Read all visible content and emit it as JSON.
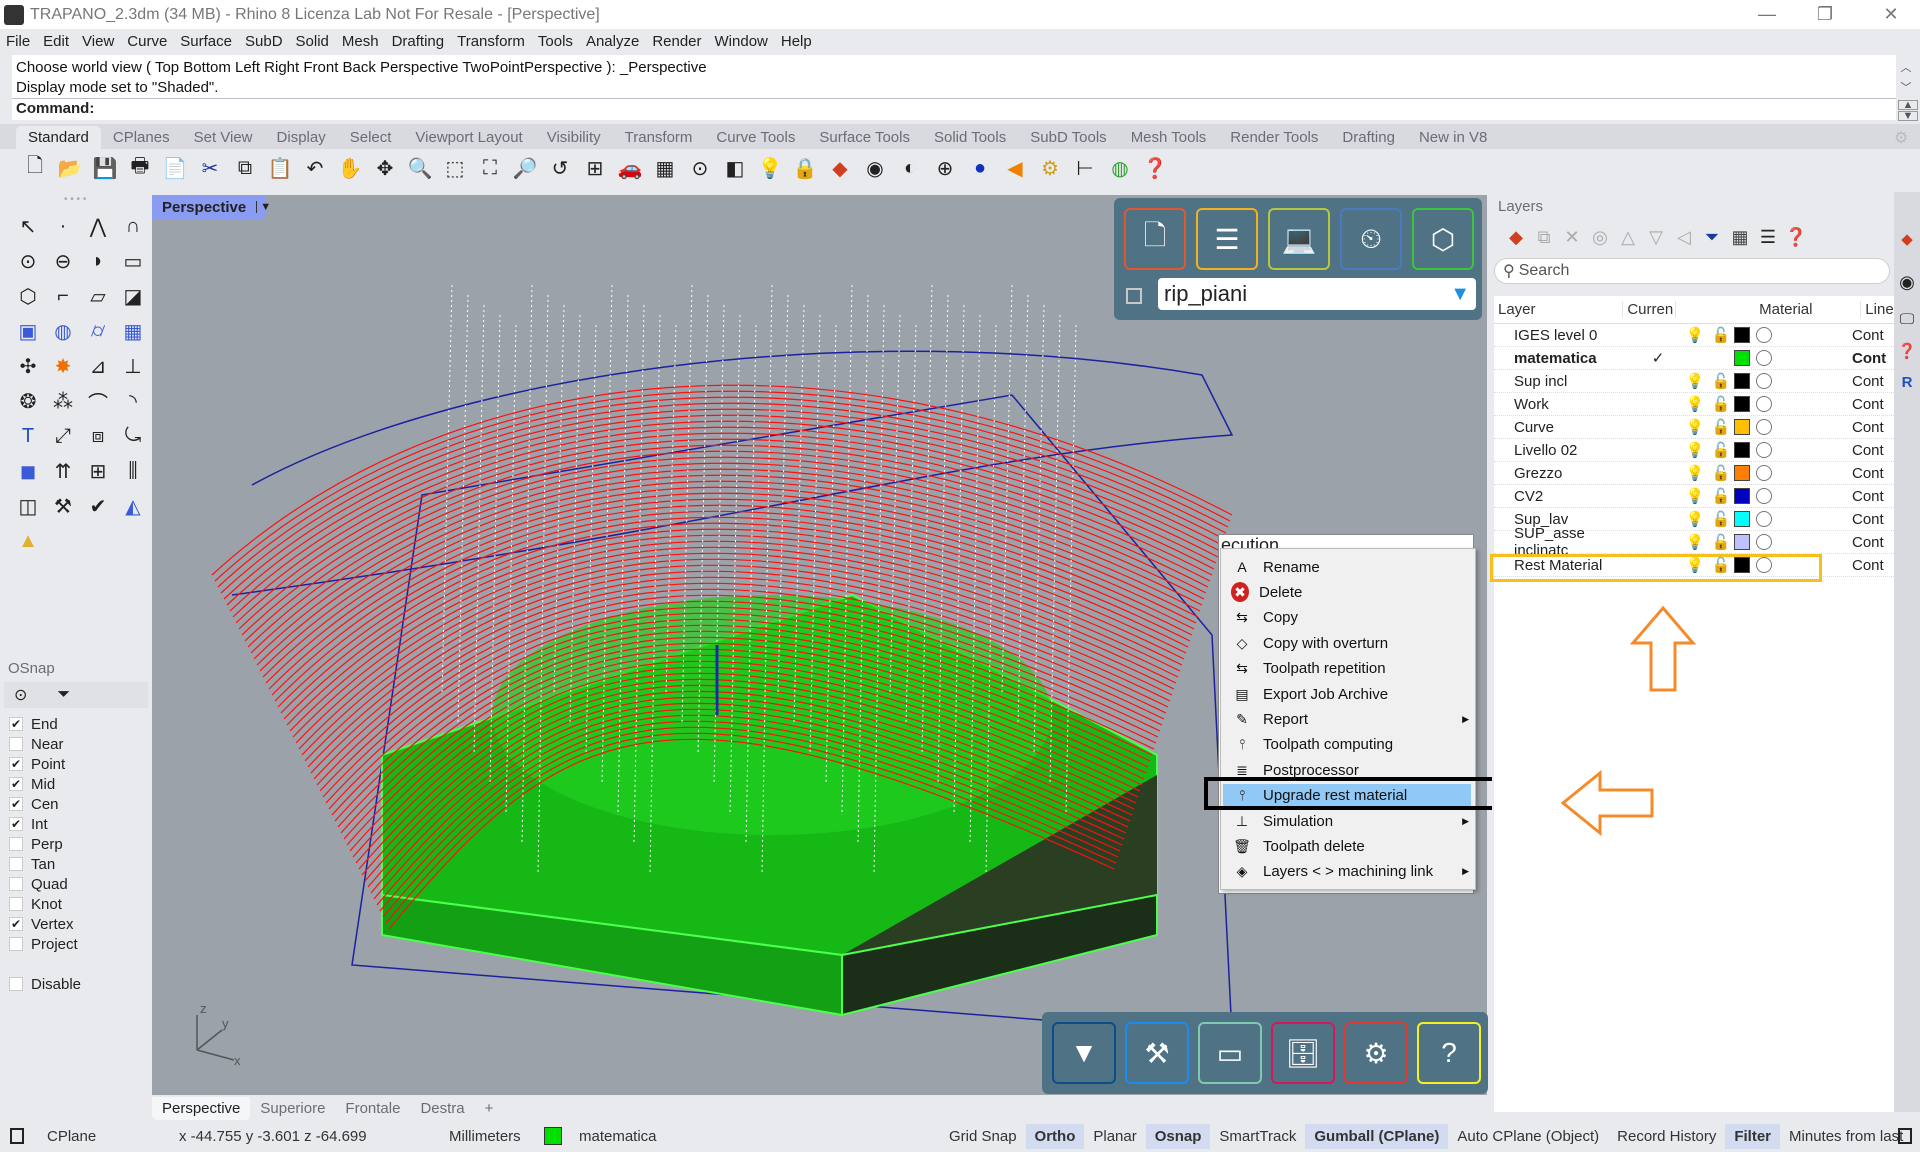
{
  "window": {
    "title": "TRAPANO_2.3dm (34 MB) - Rhino 8 Licenza Lab Not For Resale - [Perspective]",
    "minimize": "—",
    "restore": "❐",
    "close": "✕"
  },
  "menu": [
    "File",
    "Edit",
    "View",
    "Curve",
    "Surface",
    "SubD",
    "Solid",
    "Mesh",
    "Drafting",
    "Transform",
    "Tools",
    "Analyze",
    "Render",
    "Window",
    "Help"
  ],
  "command": {
    "history": [
      "Choose world view ( Top  Bottom  Left  Right  Front  Back  Perspective  TwoPointPerspective ): _Perspective",
      "Display mode set to \"Shaded\"."
    ],
    "prompt": "Command:"
  },
  "toolbar_tabs": [
    "Standard",
    "CPlanes",
    "Set View",
    "Display",
    "Select",
    "Viewport Layout",
    "Visibility",
    "Transform",
    "Curve Tools",
    "Surface Tools",
    "Solid Tools",
    "SubD Tools",
    "Mesh Tools",
    "Render Tools",
    "Drafting",
    "New in V8"
  ],
  "toolbar_icons": [
    "new-file",
    "open-folder",
    "save",
    "print",
    "import",
    "cut",
    "copy",
    "paste",
    "undo",
    "pan",
    "rotate-view",
    "zoom-dynamic",
    "zoom-window",
    "zoom-extents",
    "zoom-selected",
    "undo-view",
    "four-viewports",
    "car",
    "grid-cplane",
    "osnap",
    "shapes",
    "light-bulb",
    "lock",
    "layers",
    "color-wheel",
    "shaded-sphere",
    "wire-sphere",
    "render-sphere",
    "spotlight",
    "gear",
    "dimensions",
    "environment",
    "help"
  ],
  "viewport": {
    "name": "Perspective",
    "tabs": [
      "Perspective",
      "Superiore",
      "Frontale",
      "Destra"
    ],
    "axes": {
      "x": "x",
      "y": "y",
      "z": "z"
    }
  },
  "cam_panel": {
    "selector_value": "rip_piani",
    "top_buttons": [
      {
        "name": "new-job",
        "color": "#e2572f",
        "glyph": "🗋"
      },
      {
        "name": "machining-stack",
        "color": "#f0b020",
        "glyph": "☰"
      },
      {
        "name": "post-computer",
        "color": "#b7c63a",
        "glyph": "💻"
      },
      {
        "name": "timer",
        "color": "#4a7bc0",
        "glyph": "⏲"
      },
      {
        "name": "cubes",
        "color": "#3cc43a",
        "glyph": "⬡"
      }
    ],
    "bottom_buttons": [
      {
        "name": "tool",
        "color": "#0b4d8a",
        "glyph": "▼"
      },
      {
        "name": "machine",
        "color": "#1a8cf0",
        "glyph": "⚒"
      },
      {
        "name": "stock",
        "color": "#7fc9b0",
        "glyph": "▭"
      },
      {
        "name": "archive",
        "color": "#d01a5a",
        "glyph": "🗄"
      },
      {
        "name": "settings",
        "color": "#e03a30",
        "glyph": "⚙"
      },
      {
        "name": "help",
        "color": "#f5f020",
        "glyph": "?"
      }
    ]
  },
  "context_menu": {
    "behind_text": "ecution",
    "items": [
      {
        "label": "Rename",
        "icon": "rename-icon",
        "glyph": "A",
        "submenu": false
      },
      {
        "label": "Delete",
        "icon": "delete-icon",
        "glyph": "✖",
        "submenu": false
      },
      {
        "label": "Copy",
        "icon": "copy-icon",
        "glyph": "⇆",
        "submenu": false
      },
      {
        "label": "Copy with overturn",
        "icon": "copy-overturn-icon",
        "glyph": "◇",
        "submenu": false
      },
      {
        "label": "Toolpath repetition",
        "icon": "repetition-icon",
        "glyph": "⇆",
        "submenu": false
      },
      {
        "label": "Export Job Archive",
        "icon": "archive-icon",
        "glyph": "▤",
        "submenu": false
      },
      {
        "label": "Report",
        "icon": "report-icon",
        "glyph": "✎",
        "submenu": true
      },
      {
        "label": "Toolpath computing",
        "icon": "computing-icon",
        "glyph": "⫯",
        "submenu": false
      },
      {
        "label": "Postprocessor",
        "icon": "postprocessor-icon",
        "glyph": "≣",
        "submenu": false
      },
      {
        "label": "Upgrade rest material",
        "icon": "upgrade-icon",
        "glyph": "⫯",
        "submenu": false,
        "highlighted": true
      },
      {
        "label": "Simulation",
        "icon": "simulation-icon",
        "glyph": "⊥",
        "submenu": true
      },
      {
        "label": "Toolpath delete",
        "icon": "trash-icon",
        "glyph": "🗑",
        "submenu": false
      },
      {
        "label": "Layers < > machining link",
        "icon": "layers-link-icon",
        "glyph": "◈",
        "submenu": true
      }
    ]
  },
  "osnap": {
    "title": "OSnap",
    "items": [
      {
        "label": "End",
        "checked": true
      },
      {
        "label": "Near",
        "checked": false
      },
      {
        "label": "Point",
        "checked": true
      },
      {
        "label": "Mid",
        "checked": true
      },
      {
        "label": "Cen",
        "checked": true
      },
      {
        "label": "Int",
        "checked": true
      },
      {
        "label": "Perp",
        "checked": false
      },
      {
        "label": "Tan",
        "checked": false
      },
      {
        "label": "Quad",
        "checked": false
      },
      {
        "label": "Knot",
        "checked": false
      },
      {
        "label": "Vertex",
        "checked": true
      },
      {
        "label": "Project",
        "checked": false
      }
    ],
    "disable": {
      "label": "Disable",
      "checked": false
    }
  },
  "layers": {
    "title": "Layers",
    "search_placeholder": "Search",
    "columns": [
      "Layer",
      "Curren",
      "",
      "",
      "",
      "Material",
      "Line"
    ],
    "rows": [
      {
        "name": "IGES level 0",
        "current": false,
        "bulb": "#5b8fd8",
        "color": "#000000",
        "linetype": "Cont"
      },
      {
        "name": "matematica",
        "current": true,
        "bulb": null,
        "color": "#00e000",
        "linetype": "Cont"
      },
      {
        "name": "Sup incl",
        "current": false,
        "bulb": "#5b8fd8",
        "color": "#000000",
        "linetype": "Cont"
      },
      {
        "name": "Work",
        "current": false,
        "bulb": "#5b8fd8",
        "color": "#000000",
        "linetype": "Cont"
      },
      {
        "name": "Curve",
        "current": false,
        "bulb": "#5b8fd8",
        "color": "#ffbf00",
        "linetype": "Cont"
      },
      {
        "name": "Livello 02",
        "current": false,
        "bulb": "#f5d020",
        "color": "#000000",
        "linetype": "Cont"
      },
      {
        "name": "Grezzo",
        "current": false,
        "bulb": "#5b8fd8",
        "color": "#ff8000",
        "linetype": "Cont"
      },
      {
        "name": "CV2",
        "current": false,
        "bulb": "#f5d020",
        "color": "#0000c0",
        "linetype": "Cont"
      },
      {
        "name": "Sup_lav",
        "current": false,
        "bulb": "#5b8fd8",
        "color": "#00ffff",
        "linetype": "Cont"
      },
      {
        "name": "SUP_asse inclinatc",
        "current": false,
        "bulb": "#5b8fd8",
        "color": "#c0c0ff",
        "linetype": "Cont"
      },
      {
        "name": "Rest Material",
        "current": false,
        "bulb": "#5b8fd8",
        "color": "#000000",
        "linetype": "Cont"
      }
    ]
  },
  "statusbar": {
    "cplane": "CPlane",
    "coords": "x -44.755  y -3.601  z -64.699",
    "units": "Millimeters",
    "layer": "matematica",
    "layer_color": "#00e000",
    "toggles": [
      {
        "label": "Grid Snap",
        "on": false
      },
      {
        "label": "Ortho",
        "on": true
      },
      {
        "label": "Planar",
        "on": false
      },
      {
        "label": "Osnap",
        "on": true
      },
      {
        "label": "SmartTrack",
        "on": false
      },
      {
        "label": "Gumball (CPlane)",
        "on": true
      },
      {
        "label": "Auto CPlane (Object)",
        "on": false
      },
      {
        "label": "Record History",
        "on": false
      },
      {
        "label": "Filter",
        "on": true
      },
      {
        "label": "Minutes from last",
        "on": false
      }
    ]
  },
  "accents": {
    "viewport_tab": "#8a9cf2",
    "layer_highlight_box": "#f7bf1a",
    "arrow_color": "#f58a2a",
    "menu_highlight": "#90c8f6"
  }
}
